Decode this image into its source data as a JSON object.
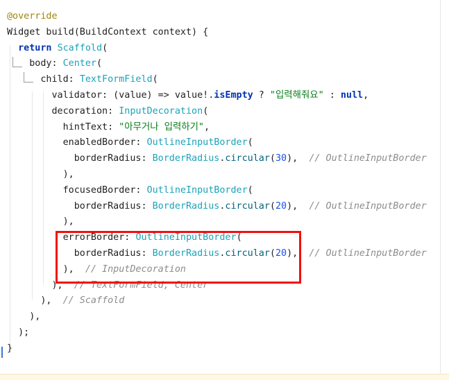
{
  "lines": [
    [
      {
        "t": "@override",
        "c": "tok-annot"
      }
    ],
    [
      {
        "t": "Widget build(BuildContext context) {",
        "c": "tok-plain"
      }
    ],
    [
      {
        "t": "  ",
        "c": "tok-plain"
      },
      {
        "t": "return",
        "c": "tok-kw"
      },
      {
        "t": " ",
        "c": "tok-plain"
      },
      {
        "t": "Scaffold",
        "c": "tok-class"
      },
      {
        "t": "(",
        "c": "tok-plain"
      }
    ],
    [
      {
        "t": "    body: ",
        "c": "tok-plain"
      },
      {
        "t": "Center",
        "c": "tok-class"
      },
      {
        "t": "(",
        "c": "tok-plain"
      }
    ],
    [
      {
        "t": "      child: ",
        "c": "tok-plain"
      },
      {
        "t": "TextFormField",
        "c": "tok-class"
      },
      {
        "t": "(",
        "c": "tok-plain"
      }
    ],
    [
      {
        "t": "        validator: (value) => value!.",
        "c": "tok-plain"
      },
      {
        "t": "isEmpty",
        "c": "tok-kw"
      },
      {
        "t": " ? ",
        "c": "tok-plain"
      },
      {
        "t": "\"입력해줘요\"",
        "c": "tok-str"
      },
      {
        "t": " : ",
        "c": "tok-plain"
      },
      {
        "t": "null",
        "c": "tok-kw"
      },
      {
        "t": ",",
        "c": "tok-plain"
      }
    ],
    [
      {
        "t": "        decoration: ",
        "c": "tok-plain"
      },
      {
        "t": "InputDecoration",
        "c": "tok-class"
      },
      {
        "t": "(",
        "c": "tok-plain"
      }
    ],
    [
      {
        "t": "          hintText: ",
        "c": "tok-plain"
      },
      {
        "t": "\"아무거나 입력하기\"",
        "c": "tok-str"
      },
      {
        "t": ",",
        "c": "tok-plain"
      }
    ],
    [
      {
        "t": "          enabledBorder: ",
        "c": "tok-plain"
      },
      {
        "t": "OutlineInputBorder",
        "c": "tok-class"
      },
      {
        "t": "(",
        "c": "tok-plain"
      }
    ],
    [
      {
        "t": "            borderRadius: ",
        "c": "tok-plain"
      },
      {
        "t": "BorderRadius",
        "c": "tok-class"
      },
      {
        "t": ".",
        "c": "tok-plain"
      },
      {
        "t": "circular",
        "c": "tok-method"
      },
      {
        "t": "(",
        "c": "tok-plain"
      },
      {
        "t": "30",
        "c": "tok-num"
      },
      {
        "t": "),  ",
        "c": "tok-plain"
      },
      {
        "t": "// OutlineInputBorder",
        "c": "tok-comment"
      }
    ],
    [
      {
        "t": "          ),",
        "c": "tok-plain"
      }
    ],
    [
      {
        "t": "          focusedBorder: ",
        "c": "tok-plain"
      },
      {
        "t": "OutlineInputBorder",
        "c": "tok-class"
      },
      {
        "t": "(",
        "c": "tok-plain"
      }
    ],
    [
      {
        "t": "            borderRadius: ",
        "c": "tok-plain"
      },
      {
        "t": "BorderRadius",
        "c": "tok-class"
      },
      {
        "t": ".",
        "c": "tok-plain"
      },
      {
        "t": "circular",
        "c": "tok-method"
      },
      {
        "t": "(",
        "c": "tok-plain"
      },
      {
        "t": "20",
        "c": "tok-num"
      },
      {
        "t": "),  ",
        "c": "tok-plain"
      },
      {
        "t": "// OutlineInputBorder",
        "c": "tok-comment"
      }
    ],
    [
      {
        "t": "          ),",
        "c": "tok-plain"
      }
    ],
    [
      {
        "t": "          errorBorder: ",
        "c": "tok-plain"
      },
      {
        "t": "OutlineInputBorder",
        "c": "tok-class"
      },
      {
        "t": "(",
        "c": "tok-plain"
      }
    ],
    [
      {
        "t": "            borderRadius: ",
        "c": "tok-plain"
      },
      {
        "t": "BorderRadius",
        "c": "tok-class"
      },
      {
        "t": ".",
        "c": "tok-plain"
      },
      {
        "t": "circular",
        "c": "tok-method"
      },
      {
        "t": "(",
        "c": "tok-plain"
      },
      {
        "t": "20",
        "c": "tok-num"
      },
      {
        "t": "),  ",
        "c": "tok-plain"
      },
      {
        "t": "// OutlineInputBorder",
        "c": "tok-comment"
      }
    ],
    [
      {
        "t": "          ),  ",
        "c": "tok-plain"
      },
      {
        "t": "// InputDecoration",
        "c": "tok-comment"
      }
    ],
    [
      {
        "t": "        ),  ",
        "c": "tok-plain"
      },
      {
        "t": "// TextFormField, Center",
        "c": "tok-comment"
      }
    ],
    [
      {
        "t": "      ),  ",
        "c": "tok-plain"
      },
      {
        "t": "// Scaffold",
        "c": "tok-comment"
      }
    ],
    [
      {
        "t": "    ),",
        "c": "tok-plain"
      }
    ],
    [
      {
        "t": "  );",
        "c": "tok-plain"
      }
    ],
    [
      {
        "t": "}",
        "c": "tok-plain"
      }
    ]
  ],
  "highlight": {
    "color": "#f20f0f",
    "target": "errorBorder"
  }
}
